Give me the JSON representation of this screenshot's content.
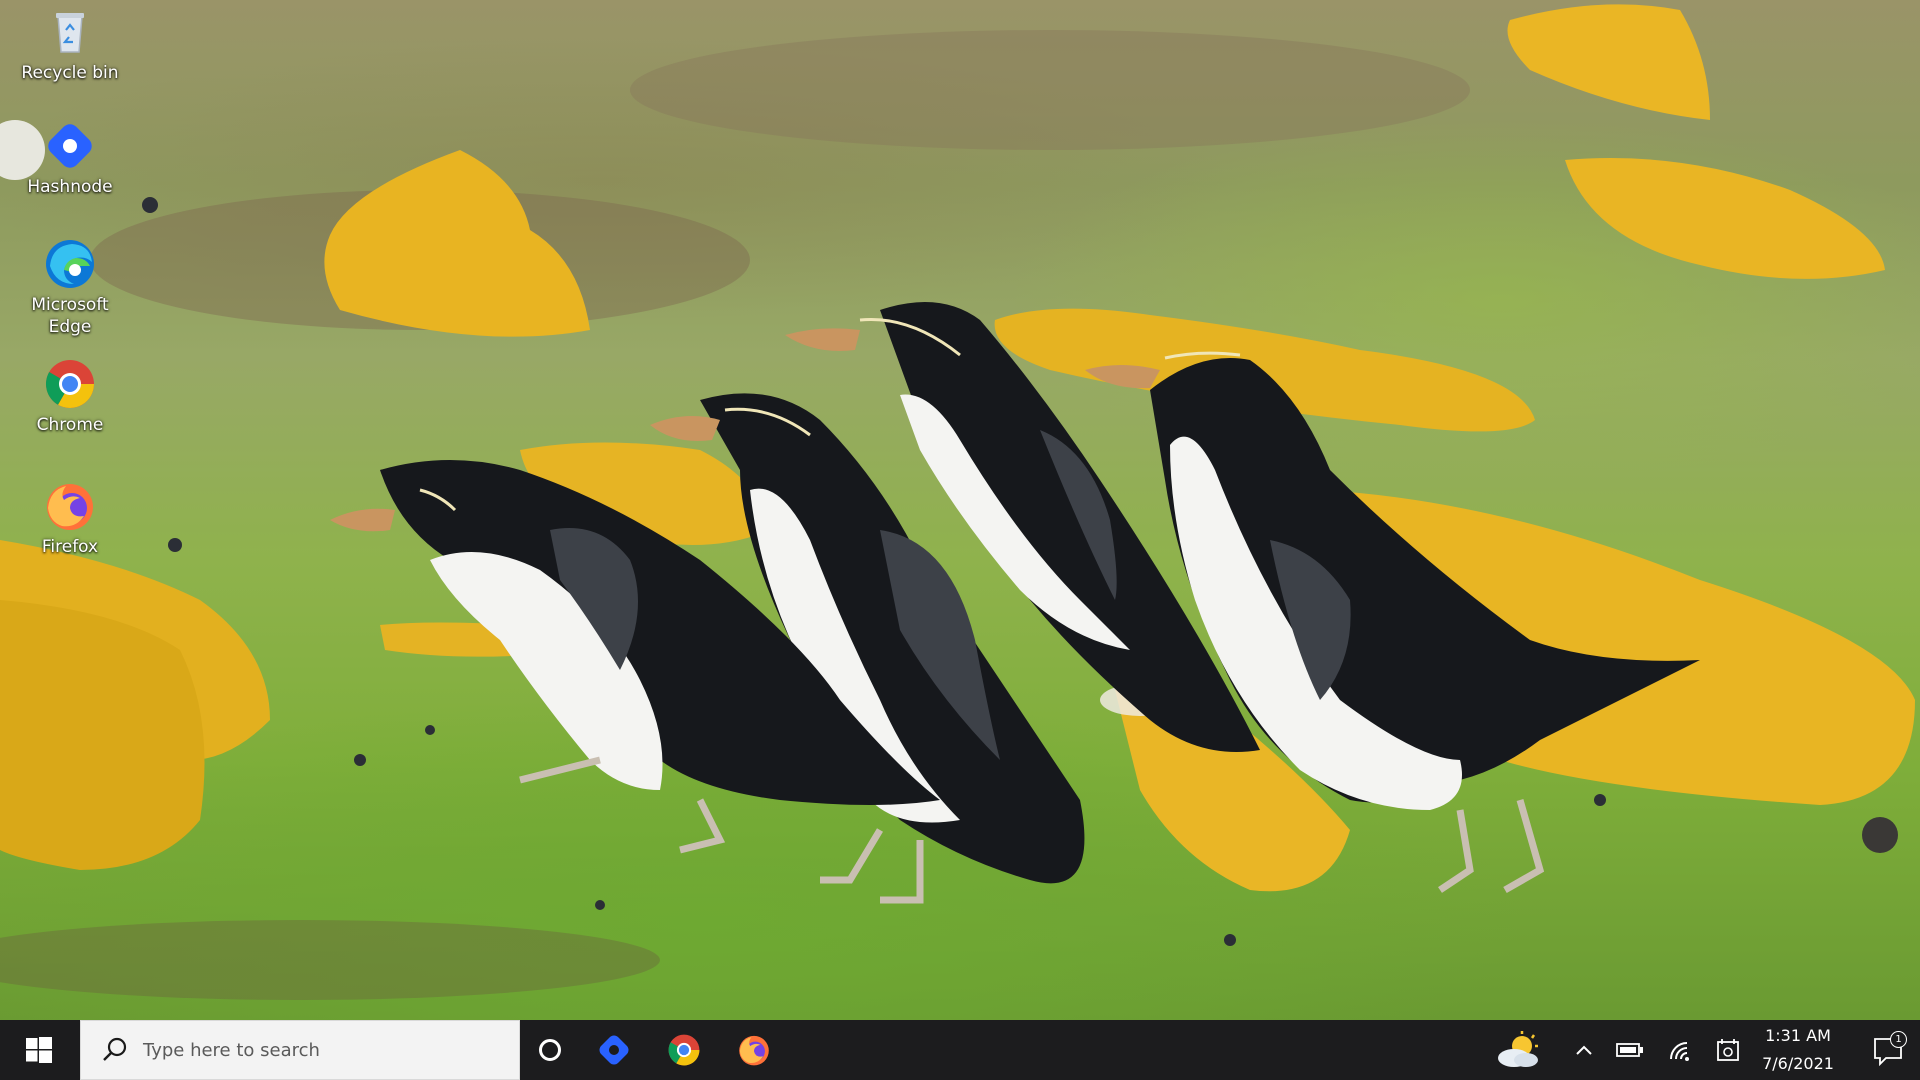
{
  "desktop": {
    "icons": [
      {
        "label": "Recycle bin",
        "icon": "recycle-bin-icon"
      },
      {
        "label": "Hashnode",
        "icon": "hashnode-icon"
      },
      {
        "label": "Microsoft Edge",
        "icon": "edge-icon"
      },
      {
        "label": "Chrome",
        "icon": "chrome-icon"
      },
      {
        "label": "Firefox",
        "icon": "firefox-icon"
      }
    ]
  },
  "taskbar": {
    "search": {
      "placeholder": "Type here to search"
    },
    "pinned": [
      "cortana-icon",
      "hashnode-icon",
      "chrome-icon",
      "firefox-icon"
    ],
    "tray": [
      "weather-icon",
      "chevron-up-icon",
      "battery-icon",
      "wifi-icon",
      "meet-now-icon"
    ],
    "clock": {
      "time": "1:31 AM",
      "date": "7/6/2021"
    },
    "notification_badge": "1"
  },
  "colors": {
    "taskbar_bg": "#1c1c1e",
    "search_bg": "#f3f3f3",
    "hashnode_blue": "#2962ff",
    "lichen_yellow": "#e8b422",
    "grass_green": "#7fae3a"
  }
}
